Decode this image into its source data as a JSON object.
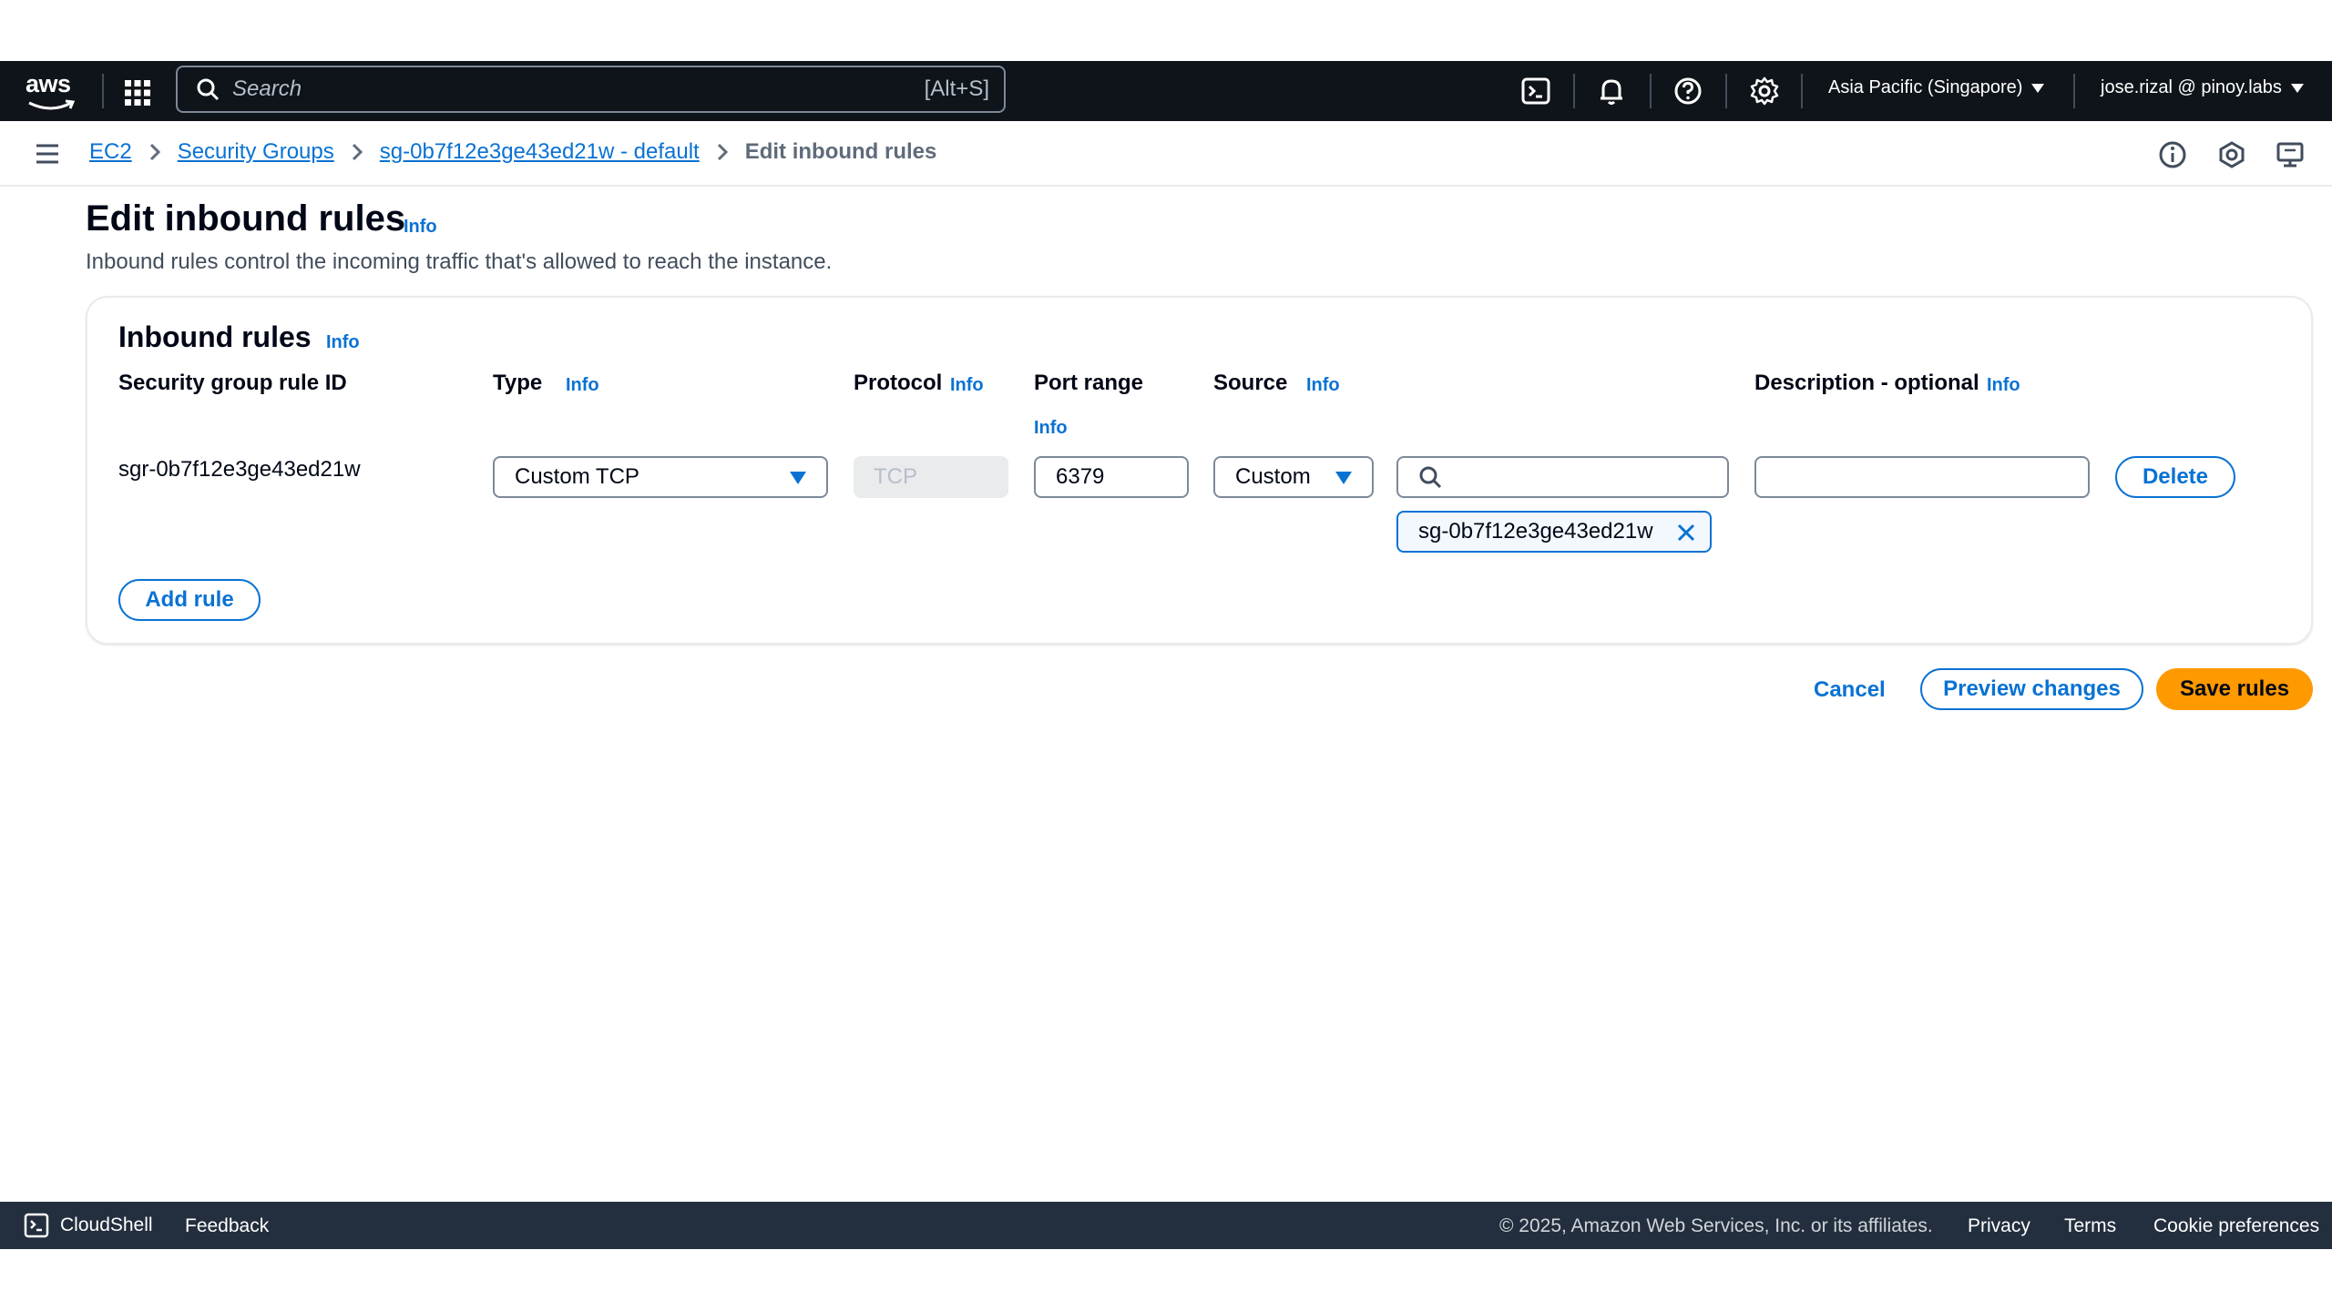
{
  "topbar": {
    "logo_text": "aws",
    "search_placeholder": "Search",
    "search_shortcut": "[Alt+S]",
    "region": "Asia Pacific (Singapore)",
    "account": "jose.rizal @ pinoy.labs",
    "icons": [
      "cloudshell-icon",
      "bell-icon",
      "help-icon",
      "gear-icon"
    ]
  },
  "breadcrumb": {
    "items": [
      "EC2",
      "Security Groups",
      "sg-0b7f12e3ge43ed21w - default"
    ],
    "current": "Edit inbound rules"
  },
  "page": {
    "title": "Edit inbound rules",
    "title_info": "Info",
    "subtitle": "Inbound rules control the incoming traffic that's allowed to reach the instance."
  },
  "panel": {
    "title": "Inbound rules",
    "title_info": "Info",
    "columns": {
      "rule_id": "Security group rule ID",
      "type": "Type",
      "type_info": "Info",
      "protocol": "Protocol",
      "protocol_info": "Info",
      "port_range": "Port range",
      "port_range_info": "Info",
      "source": "Source",
      "source_info": "Info",
      "description": "Description - optional",
      "description_info": "Info"
    },
    "rule": {
      "id": "sgr-0b7f12e3ge43ed21w",
      "type": "Custom TCP",
      "protocol": "TCP",
      "port": "6379",
      "source": "Custom",
      "source_search": "",
      "source_token": "sg-0b7f12e3ge43ed21w",
      "description": "",
      "delete_label": "Delete"
    },
    "add_rule_label": "Add rule"
  },
  "actions": {
    "cancel": "Cancel",
    "preview": "Preview changes",
    "save": "Save rules"
  },
  "footer": {
    "cloudshell": "CloudShell",
    "feedback": "Feedback",
    "copyright": "© 2025, Amazon Web Services, Inc. or its affiliates.",
    "links": [
      "Privacy",
      "Terms",
      "Cookie preferences"
    ]
  },
  "colors": {
    "topbar": "#0f141a",
    "link": "#0972d3",
    "primary": "#ff9900",
    "footer": "#232f3e"
  }
}
